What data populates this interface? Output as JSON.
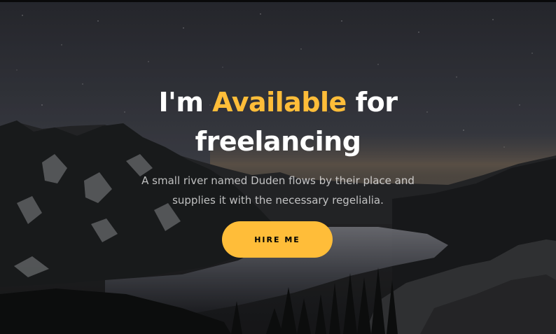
{
  "hero": {
    "headline_prefix": "I'm",
    "headline_accent": "Available",
    "headline_suffix": "for",
    "headline_line2": "freelancing",
    "subtext": "A small river named Duden flows by their place and supplies it with the necessary regelialia.",
    "button_label": "HIRE ME"
  },
  "colors": {
    "accent": "#ffbd39",
    "text": "#ffffff"
  }
}
